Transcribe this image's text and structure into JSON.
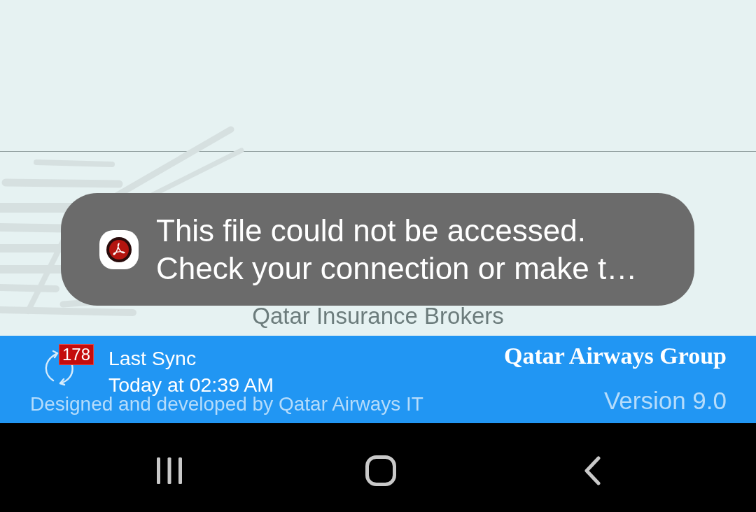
{
  "content": {
    "subtitle": "Qatar Insurance Brokers"
  },
  "toast": {
    "message_lines": [
      "This file could not be accessed.",
      "Check your connection or make t…"
    ]
  },
  "footer": {
    "sync_count": "178",
    "sync_label": "Last Sync",
    "sync_time": "Today at 02:39 AM",
    "credit": "Designed and developed by Qatar Airways IT",
    "brand": "Qatar Airways Group",
    "version": "Version 9.0"
  },
  "nav_bar": {
    "buttons": [
      {
        "kind": "recents"
      },
      {
        "kind": "home"
      },
      {
        "kind": "back"
      }
    ]
  }
}
